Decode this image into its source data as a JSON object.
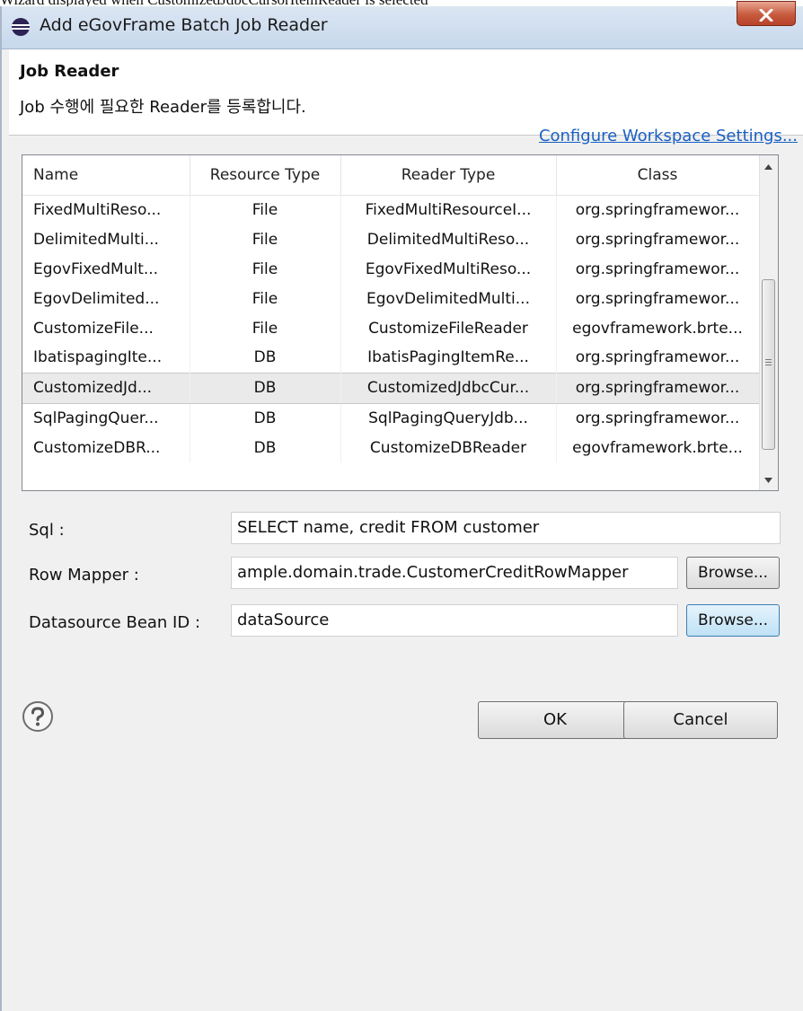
{
  "caption": "Wizard displayed when CustomizedJdbcCursorItemReader is selected",
  "window": {
    "title": "Add eGovFrame Batch Job Reader",
    "app_icon": "eclipse-icon",
    "close_icon": "close-icon"
  },
  "header": {
    "title": "Job Reader",
    "description": "Job 수행에 필요한 Reader를 등록합니다."
  },
  "link": "Configure Workspace Settings...",
  "table": {
    "columns": [
      "Name",
      "Resource Type",
      "Reader Type",
      "Class"
    ],
    "rows": [
      [
        "FixedMultiReso...",
        "File",
        "FixedMultiResourceI...",
        "org.springframewor..."
      ],
      [
        "DelimitedMulti...",
        "File",
        "DelimitedMultiReso...",
        "org.springframewor..."
      ],
      [
        "EgovFixedMult...",
        "File",
        "EgovFixedMultiReso...",
        "org.springframewor..."
      ],
      [
        "EgovDelimited...",
        "File",
        "EgovDelimitedMulti...",
        "org.springframewor..."
      ],
      [
        "CustomizeFile...",
        "File",
        "CustomizeFileReader",
        "egovframework.brte..."
      ],
      [
        "IbatispagingIte...",
        "DB",
        "IbatisPagingItemRe...",
        "org.springframewor..."
      ],
      [
        "CustomizedJd...",
        "DB",
        "CustomizedJdbcCur...",
        "org.springframewor..."
      ],
      [
        "SqlPagingQuer...",
        "DB",
        "SqlPagingQueryJdb...",
        "org.springframewor..."
      ],
      [
        "CustomizeDBR...",
        "DB",
        "CustomizeDBReader",
        "egovframework.brte..."
      ]
    ],
    "selected_row": 6
  },
  "form": {
    "sql_label": "Sql :",
    "sql_value": "SELECT name, credit FROM customer",
    "row_mapper_label": "Row Mapper :",
    "row_mapper_value": "ample.domain.trade.CustomerCreditRowMapper",
    "datasource_label": "Datasource Bean ID :",
    "datasource_value": "dataSource",
    "browse_label": "Browse..."
  },
  "buttons": {
    "ok": "OK",
    "cancel": "Cancel",
    "help_icon": "help-icon"
  },
  "colors": {
    "link": "#1a60c2",
    "titlebar": "#c7d8ec",
    "close": "#c75b3e",
    "focus_button": "#bfe1f5"
  }
}
